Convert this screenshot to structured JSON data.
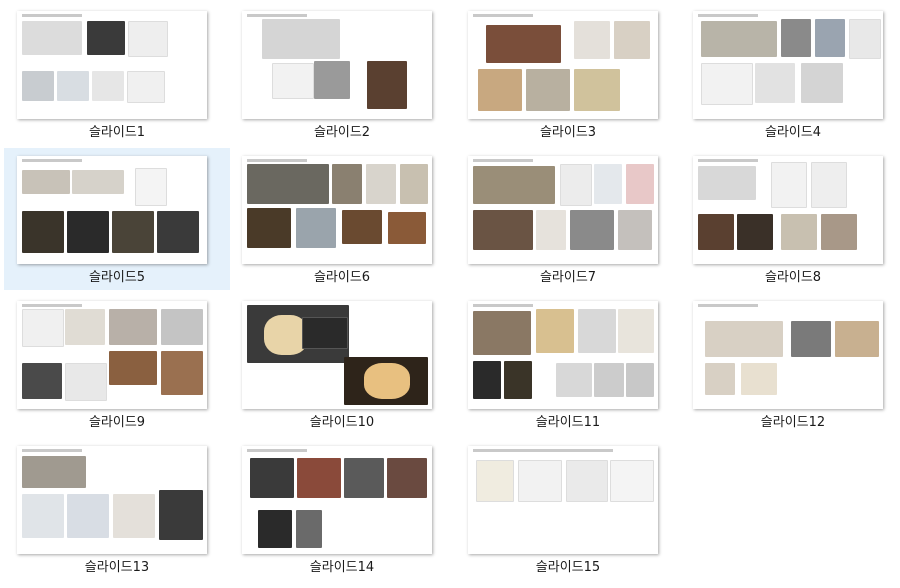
{
  "slides": [
    {
      "label": "슬라이드1"
    },
    {
      "label": "슬라이드2"
    },
    {
      "label": "슬라이드3"
    },
    {
      "label": "슬라이드4"
    },
    {
      "label": "슬라이드5",
      "selected": true
    },
    {
      "label": "슬라이드6"
    },
    {
      "label": "슬라이드7"
    },
    {
      "label": "슬라이드8"
    },
    {
      "label": "슬라이드9"
    },
    {
      "label": "슬라이드10"
    },
    {
      "label": "슬라이드11"
    },
    {
      "label": "슬라이드12"
    },
    {
      "label": "슬라이드13"
    },
    {
      "label": "슬라이드14"
    },
    {
      "label": "슬라이드15"
    }
  ],
  "colors": {
    "selected_bg": "#e5f1fb",
    "caption": "#1a1a1a"
  }
}
